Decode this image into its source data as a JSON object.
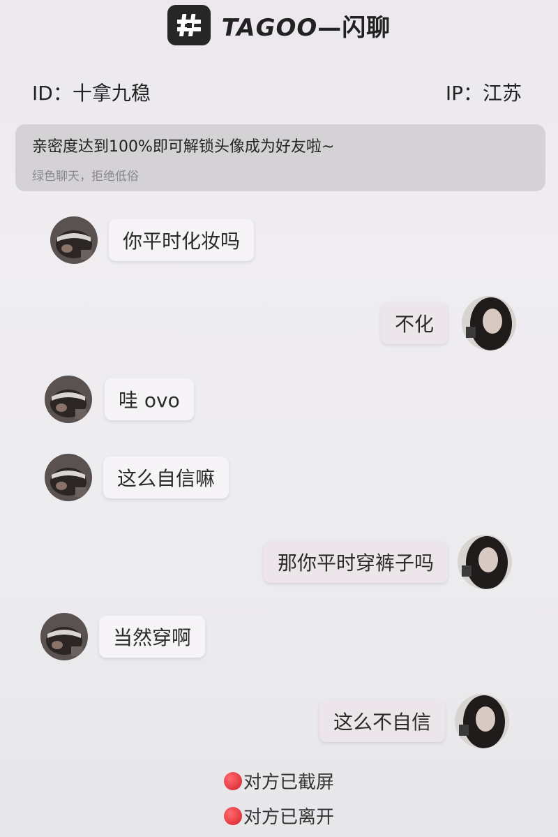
{
  "header": {
    "title_latin": "TAGOO",
    "title_dash": "—",
    "title_cn": "闪聊"
  },
  "info": {
    "id_text": "ID：十拿九稳",
    "ip_text": "IP：江苏"
  },
  "notice": {
    "main": "亲密度达到100%即可解锁头像成为好友啦~",
    "sub": "绿色聊天，拒绝低俗"
  },
  "messages": [
    {
      "side": "other",
      "text": "你平时化妆吗"
    },
    {
      "side": "me",
      "text": "不化"
    },
    {
      "side": "other",
      "text": "哇 ovo"
    },
    {
      "side": "other",
      "text": "这么自信嘛"
    },
    {
      "side": "me",
      "text": "那你平时穿裤子吗"
    },
    {
      "side": "other",
      "text": "当然穿啊"
    },
    {
      "side": "me",
      "text": "这么不自信"
    }
  ],
  "system": [
    {
      "text": "对方已截屏",
      "dot_color": "#d4202a"
    },
    {
      "text": "对方已离开",
      "dot_color": "#d4202a"
    }
  ],
  "colors": {
    "background": "#ecebee",
    "notice_bg": "#d4d2d5",
    "logo_bg": "#262626",
    "alert_red": "#d4202a"
  },
  "icons": {
    "logo": "hash-logo-icon",
    "other_avatar": "avatar-photo-other",
    "me_avatar": "avatar-photo-me",
    "status_dot": "red-dot-icon"
  }
}
